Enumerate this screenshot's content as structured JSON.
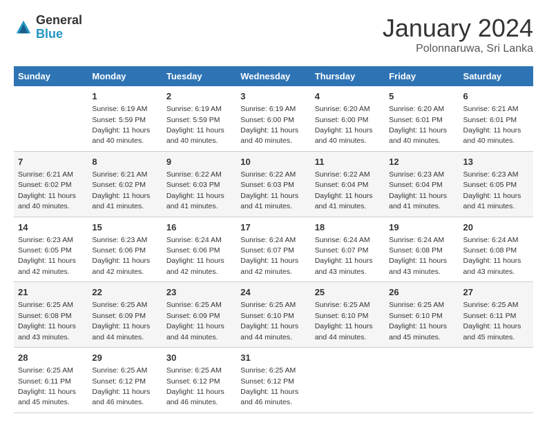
{
  "header": {
    "logo_general": "General",
    "logo_blue": "Blue",
    "month_year": "January 2024",
    "location": "Polonnaruwa, Sri Lanka"
  },
  "weekdays": [
    "Sunday",
    "Monday",
    "Tuesday",
    "Wednesday",
    "Thursday",
    "Friday",
    "Saturday"
  ],
  "weeks": [
    [
      {
        "day": "",
        "sunrise": "",
        "sunset": "",
        "daylight": ""
      },
      {
        "day": "1",
        "sunrise": "Sunrise: 6:19 AM",
        "sunset": "Sunset: 5:59 PM",
        "daylight": "Daylight: 11 hours and 40 minutes."
      },
      {
        "day": "2",
        "sunrise": "Sunrise: 6:19 AM",
        "sunset": "Sunset: 5:59 PM",
        "daylight": "Daylight: 11 hours and 40 minutes."
      },
      {
        "day": "3",
        "sunrise": "Sunrise: 6:19 AM",
        "sunset": "Sunset: 6:00 PM",
        "daylight": "Daylight: 11 hours and 40 minutes."
      },
      {
        "day": "4",
        "sunrise": "Sunrise: 6:20 AM",
        "sunset": "Sunset: 6:00 PM",
        "daylight": "Daylight: 11 hours and 40 minutes."
      },
      {
        "day": "5",
        "sunrise": "Sunrise: 6:20 AM",
        "sunset": "Sunset: 6:01 PM",
        "daylight": "Daylight: 11 hours and 40 minutes."
      },
      {
        "day": "6",
        "sunrise": "Sunrise: 6:21 AM",
        "sunset": "Sunset: 6:01 PM",
        "daylight": "Daylight: 11 hours and 40 minutes."
      }
    ],
    [
      {
        "day": "7",
        "sunrise": "Sunrise: 6:21 AM",
        "sunset": "Sunset: 6:02 PM",
        "daylight": "Daylight: 11 hours and 40 minutes."
      },
      {
        "day": "8",
        "sunrise": "Sunrise: 6:21 AM",
        "sunset": "Sunset: 6:02 PM",
        "daylight": "Daylight: 11 hours and 41 minutes."
      },
      {
        "day": "9",
        "sunrise": "Sunrise: 6:22 AM",
        "sunset": "Sunset: 6:03 PM",
        "daylight": "Daylight: 11 hours and 41 minutes."
      },
      {
        "day": "10",
        "sunrise": "Sunrise: 6:22 AM",
        "sunset": "Sunset: 6:03 PM",
        "daylight": "Daylight: 11 hours and 41 minutes."
      },
      {
        "day": "11",
        "sunrise": "Sunrise: 6:22 AM",
        "sunset": "Sunset: 6:04 PM",
        "daylight": "Daylight: 11 hours and 41 minutes."
      },
      {
        "day": "12",
        "sunrise": "Sunrise: 6:23 AM",
        "sunset": "Sunset: 6:04 PM",
        "daylight": "Daylight: 11 hours and 41 minutes."
      },
      {
        "day": "13",
        "sunrise": "Sunrise: 6:23 AM",
        "sunset": "Sunset: 6:05 PM",
        "daylight": "Daylight: 11 hours and 41 minutes."
      }
    ],
    [
      {
        "day": "14",
        "sunrise": "Sunrise: 6:23 AM",
        "sunset": "Sunset: 6:05 PM",
        "daylight": "Daylight: 11 hours and 42 minutes."
      },
      {
        "day": "15",
        "sunrise": "Sunrise: 6:23 AM",
        "sunset": "Sunset: 6:06 PM",
        "daylight": "Daylight: 11 hours and 42 minutes."
      },
      {
        "day": "16",
        "sunrise": "Sunrise: 6:24 AM",
        "sunset": "Sunset: 6:06 PM",
        "daylight": "Daylight: 11 hours and 42 minutes."
      },
      {
        "day": "17",
        "sunrise": "Sunrise: 6:24 AM",
        "sunset": "Sunset: 6:07 PM",
        "daylight": "Daylight: 11 hours and 42 minutes."
      },
      {
        "day": "18",
        "sunrise": "Sunrise: 6:24 AM",
        "sunset": "Sunset: 6:07 PM",
        "daylight": "Daylight: 11 hours and 43 minutes."
      },
      {
        "day": "19",
        "sunrise": "Sunrise: 6:24 AM",
        "sunset": "Sunset: 6:08 PM",
        "daylight": "Daylight: 11 hours and 43 minutes."
      },
      {
        "day": "20",
        "sunrise": "Sunrise: 6:24 AM",
        "sunset": "Sunset: 6:08 PM",
        "daylight": "Daylight: 11 hours and 43 minutes."
      }
    ],
    [
      {
        "day": "21",
        "sunrise": "Sunrise: 6:25 AM",
        "sunset": "Sunset: 6:08 PM",
        "daylight": "Daylight: 11 hours and 43 minutes."
      },
      {
        "day": "22",
        "sunrise": "Sunrise: 6:25 AM",
        "sunset": "Sunset: 6:09 PM",
        "daylight": "Daylight: 11 hours and 44 minutes."
      },
      {
        "day": "23",
        "sunrise": "Sunrise: 6:25 AM",
        "sunset": "Sunset: 6:09 PM",
        "daylight": "Daylight: 11 hours and 44 minutes."
      },
      {
        "day": "24",
        "sunrise": "Sunrise: 6:25 AM",
        "sunset": "Sunset: 6:10 PM",
        "daylight": "Daylight: 11 hours and 44 minutes."
      },
      {
        "day": "25",
        "sunrise": "Sunrise: 6:25 AM",
        "sunset": "Sunset: 6:10 PM",
        "daylight": "Daylight: 11 hours and 44 minutes."
      },
      {
        "day": "26",
        "sunrise": "Sunrise: 6:25 AM",
        "sunset": "Sunset: 6:10 PM",
        "daylight": "Daylight: 11 hours and 45 minutes."
      },
      {
        "day": "27",
        "sunrise": "Sunrise: 6:25 AM",
        "sunset": "Sunset: 6:11 PM",
        "daylight": "Daylight: 11 hours and 45 minutes."
      }
    ],
    [
      {
        "day": "28",
        "sunrise": "Sunrise: 6:25 AM",
        "sunset": "Sunset: 6:11 PM",
        "daylight": "Daylight: 11 hours and 45 minutes."
      },
      {
        "day": "29",
        "sunrise": "Sunrise: 6:25 AM",
        "sunset": "Sunset: 6:12 PM",
        "daylight": "Daylight: 11 hours and 46 minutes."
      },
      {
        "day": "30",
        "sunrise": "Sunrise: 6:25 AM",
        "sunset": "Sunset: 6:12 PM",
        "daylight": "Daylight: 11 hours and 46 minutes."
      },
      {
        "day": "31",
        "sunrise": "Sunrise: 6:25 AM",
        "sunset": "Sunset: 6:12 PM",
        "daylight": "Daylight: 11 hours and 46 minutes."
      },
      {
        "day": "",
        "sunrise": "",
        "sunset": "",
        "daylight": ""
      },
      {
        "day": "",
        "sunrise": "",
        "sunset": "",
        "daylight": ""
      },
      {
        "day": "",
        "sunrise": "",
        "sunset": "",
        "daylight": ""
      }
    ]
  ]
}
